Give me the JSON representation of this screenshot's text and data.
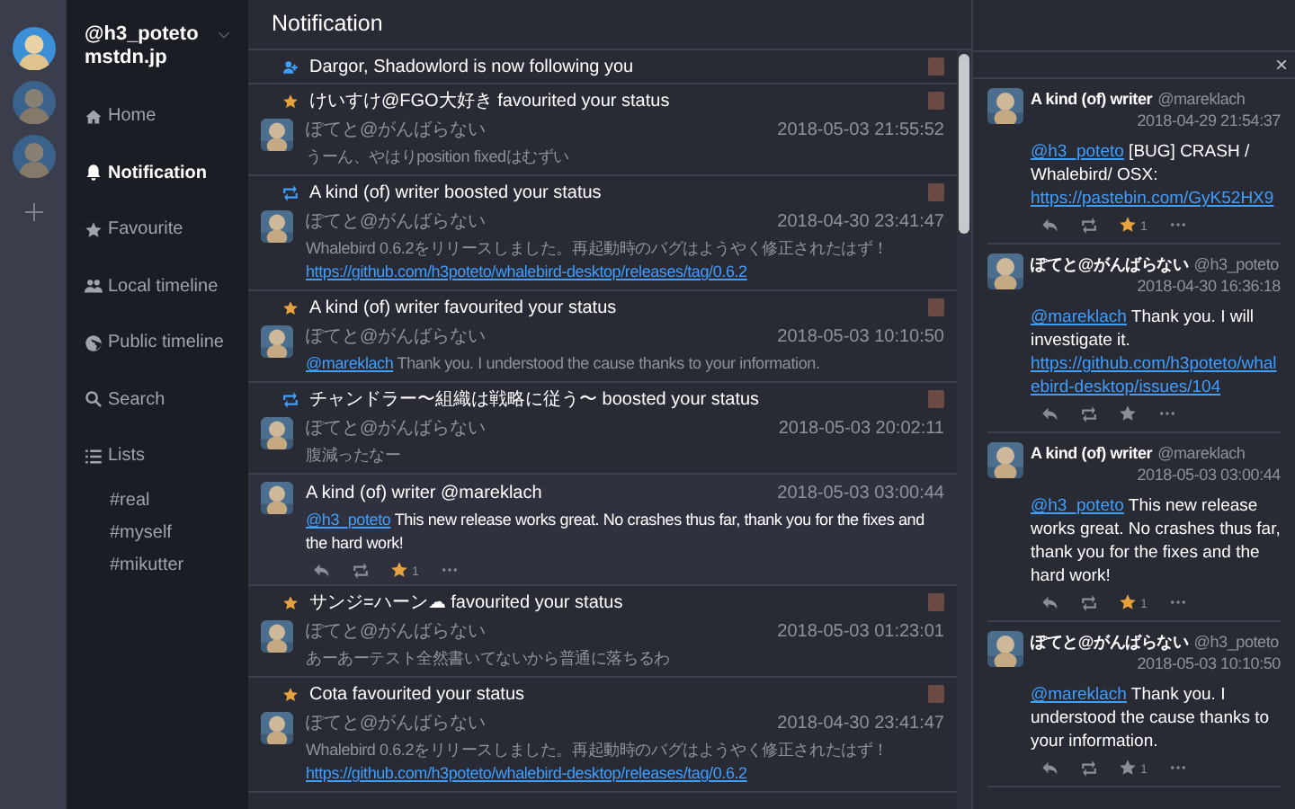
{
  "accounts": [
    {
      "selected": true
    },
    {
      "selected": false
    },
    {
      "selected": false
    }
  ],
  "sidebar": {
    "account": "@h3_poteto",
    "domain": "mstdn.jp",
    "menu": [
      {
        "label": "Home",
        "kind": "home",
        "selected": false
      },
      {
        "label": "Notification",
        "kind": "bell",
        "selected": true
      },
      {
        "label": "Favourite",
        "kind": "star",
        "selected": false
      },
      {
        "label": "Local timeline",
        "kind": "users",
        "selected": false
      },
      {
        "label": "Public timeline",
        "kind": "globe",
        "selected": false
      },
      {
        "label": "Search",
        "kind": "search",
        "selected": false
      },
      {
        "label": "Lists",
        "kind": "list",
        "selected": false,
        "children": [
          {
            "label": "#real",
            "selected": false
          },
          {
            "label": "#myself",
            "selected": false
          },
          {
            "label": "#mikutter",
            "selected": false
          }
        ]
      }
    ]
  },
  "header": {
    "title": "Notification"
  },
  "notifications": [
    {
      "kind": "follow",
      "title": "Dargor, Shadowlord is now following you"
    },
    {
      "kind": "favourite",
      "title": "けいすけ@FGO大好き favourited your status",
      "name": "ぽてと@がんばらない",
      "time": "2018-05-03 21:55:52",
      "body": [
        {
          "kind": "text",
          "text": "うーん、やはりposition fixedはむずい"
        }
      ]
    },
    {
      "kind": "reblog",
      "title": "A kind (of) writer boosted your status",
      "name": "ぽてと@がんばらない",
      "time": "2018-04-30 23:41:47",
      "body": [
        {
          "kind": "text",
          "text": "Whalebird 0.6.2をリリースしました。再起動時のバグはようやく修正されたはず！"
        },
        {
          "kind": "url",
          "text": "https://github.com/h3poteto/whalebird-desktop/releases/tag/0.6.2"
        }
      ]
    },
    {
      "kind": "favourite",
      "title": "A kind (of) writer favourited your status",
      "name": "ぽてと@がんばらない",
      "time": "2018-05-03 10:10:50",
      "body": [
        {
          "kind": "mention",
          "text": "@mareklach"
        },
        {
          "kind": "text",
          "text": " Thank you. I understood the cause thanks to your information."
        }
      ]
    },
    {
      "kind": "reblog",
      "title": "チャンドラー〜組織は戦略に従う〜 boosted your status",
      "name": "ぽてと@がんばらない",
      "time": "2018-05-03 20:02:11",
      "body": [
        {
          "kind": "text",
          "text": "腹減ったなー"
        }
      ]
    },
    {
      "kind": "mention",
      "name": "A kind (of) writer @mareklach",
      "time": "2018-05-03 03:00:44",
      "body": [
        {
          "kind": "mention",
          "text": "@h3_poteto"
        },
        {
          "kind": "text",
          "text": " This new release works great. No crashes thus far, thank you for the fixes and the hard work!"
        }
      ],
      "favourited": true,
      "favourites": "1"
    },
    {
      "kind": "favourite",
      "title": "サンジ=ハーン☁ favourited your status",
      "name": "ぽてと@がんばらない",
      "time": "2018-05-03 01:23:01",
      "body": [
        {
          "kind": "text",
          "text": "あーあーテスト全然書いてないから普通に落ちるわ"
        }
      ]
    },
    {
      "kind": "favourite",
      "title": "Cota favourited your status",
      "name": "ぽてと@がんばらない",
      "time": "2018-04-30 23:41:47",
      "body": [
        {
          "kind": "text",
          "text": "Whalebird 0.6.2をリリースしました。再起動時のバグはようやく修正されたはず！"
        },
        {
          "kind": "url",
          "text": "https://github.com/h3poteto/whalebird-desktop/releases/tag/0.6.2"
        }
      ]
    }
  ],
  "thread": {
    "close": "×",
    "toots": [
      {
        "name": "A kind (of) writer",
        "acct": "@mareklach",
        "time": "2018-04-29 21:54:37",
        "body": [
          {
            "kind": "mention",
            "text": "@h3_poteto"
          },
          {
            "kind": "text",
            "text": " [BUG] CRASH / Whalebird/ OSX:"
          },
          {
            "kind": "url",
            "text": "https://pastebin.com/GyK52HX9"
          }
        ],
        "favourited": true,
        "favourites": "1"
      },
      {
        "name": "ぽてと@がんばらない",
        "acct": "@h3_poteto",
        "time": "2018-04-30 16:36:18",
        "body": [
          {
            "kind": "mention",
            "text": "@mareklach"
          },
          {
            "kind": "text",
            "text": " Thank you. I will investigate it."
          },
          {
            "kind": "url",
            "text": "https://github.com/h3poteto/whalebird-desktop/issues/104"
          }
        ],
        "favourited": false
      },
      {
        "name": "A kind (of) writer",
        "acct": "@mareklach",
        "time": "2018-05-03 03:00:44",
        "body": [
          {
            "kind": "mention",
            "text": "@h3_poteto"
          },
          {
            "kind": "text",
            "text": " This new release works great. No crashes thus far, thank you for the fixes and the hard work!"
          }
        ],
        "favourited": true,
        "favourites": "1"
      },
      {
        "name": "ぽてと@がんばらない",
        "acct": "@h3_poteto",
        "time": "2018-05-03 10:10:50",
        "body": [
          {
            "kind": "mention",
            "text": "@mareklach"
          },
          {
            "kind": "text",
            "text": " Thank you. I understood the cause thanks to your information."
          }
        ],
        "favourited": false,
        "favourites": "1"
      }
    ]
  }
}
